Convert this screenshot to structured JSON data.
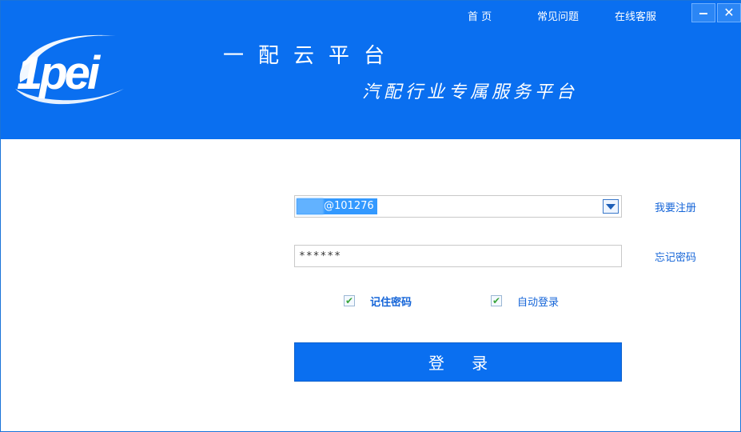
{
  "header": {
    "logo_text": "1pei",
    "title": "一配云平台",
    "slogan": "汽配行业专属服务平台"
  },
  "nav": {
    "items": [
      "首 页",
      "常见问题",
      "在线客服"
    ]
  },
  "window_controls": {
    "minimize_icon": "minimize-icon",
    "close_icon": "close-icon"
  },
  "login": {
    "account_value": "@101276",
    "password_value": "******",
    "register_label": "我要注册",
    "forgot_label": "忘记密码",
    "remember_label": "记住密码",
    "remember_checked": true,
    "auto_login_label": "自动登录",
    "auto_login_checked": true,
    "submit_label": "登 录"
  },
  "colors": {
    "header_bg": "#0a6ff0",
    "link": "#1565d8",
    "selection": "#3399ff"
  }
}
